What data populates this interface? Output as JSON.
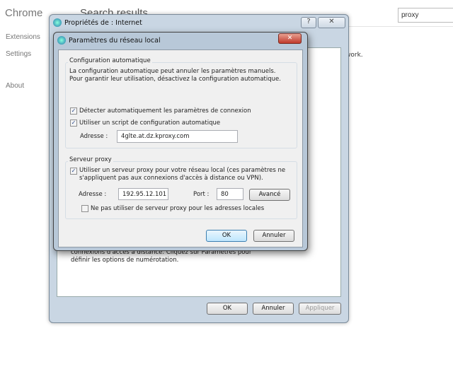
{
  "chrome": {
    "app_title": "Chrome",
    "page_title": "Search results",
    "search_value": "proxy",
    "sidebar": [
      {
        "label": "Extensions"
      },
      {
        "label": "Settings"
      },
      {
        "label": "About"
      }
    ],
    "partial_text": "work."
  },
  "outer_dialog": {
    "title": "Propriétés de : Internet",
    "help": "?",
    "close": "✕",
    "behind_text_1": "connexions d'accès à distance. Cliquez sur Paramètres pour",
    "behind_text_2": "définir les options de numérotation.",
    "ok": "OK",
    "cancel": "Annuler",
    "apply": "Appliquer"
  },
  "lan_dialog": {
    "title": "Paramètres du réseau local",
    "close": "✕",
    "auto_config": {
      "label": "Configuration automatique",
      "description": "La configuration automatique peut annuler les paramètres manuels. Pour garantir leur utilisation, désactivez la configuration automatique.",
      "detect_label": "Détecter automatiquement les paramètres de connexion",
      "detect_checked": true,
      "script_label": "Utiliser un script de configuration automatique",
      "script_checked": true,
      "address_label": "Adresse :",
      "address_value": "4glte.at.dz.kproxy.com"
    },
    "proxy": {
      "label": "Serveur proxy",
      "use_proxy_label": "Utiliser un serveur proxy pour votre réseau local (ces paramètres ne s'appliquent pas aux connexions d'accès à distance ou VPN).",
      "use_proxy_checked": true,
      "address_label": "Adresse :",
      "address_value": "192.95.12.101",
      "port_label": "Port :",
      "port_value": "80",
      "advanced": "Avancé",
      "bypass_label": "Ne pas utiliser de serveur proxy pour les adresses locales",
      "bypass_checked": false
    },
    "ok": "OK",
    "cancel": "Annuler"
  }
}
